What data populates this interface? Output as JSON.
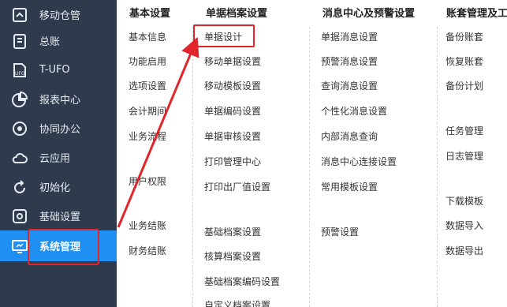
{
  "sidebar": {
    "items": [
      {
        "label": "移动仓管",
        "icon": "warehouse-icon"
      },
      {
        "label": "总账",
        "icon": "ledger-icon"
      },
      {
        "label": "T-UFO",
        "icon": "ufo-report-icon"
      },
      {
        "label": "报表中心",
        "icon": "pie-chart-icon"
      },
      {
        "label": "协同办公",
        "icon": "collaboration-icon"
      },
      {
        "label": "云应用",
        "icon": "cloud-icon"
      },
      {
        "label": "初始化",
        "icon": "refresh-icon"
      },
      {
        "label": "基础设置",
        "icon": "gear-icon"
      },
      {
        "label": "系统管理",
        "icon": "monitor-icon",
        "active": true
      }
    ],
    "active_color": "#1f8ff1"
  },
  "columns": [
    {
      "heading": "基本设置",
      "items": [
        "基本信息",
        "功能启用",
        "选项设置",
        "会计期间",
        "业务流程",
        "用户权限",
        "业务结账",
        "财务结账"
      ]
    },
    {
      "heading": "单据档案设置",
      "items": [
        "单据设计",
        "移动单据设置",
        "移动模板设置",
        "单据编码设置",
        "单据审核设置",
        "打印管理中心",
        "打印出厂值设置",
        "基础档案设置",
        "核算档案设置",
        "基础档案编码设置",
        "自定义档案设置"
      ]
    },
    {
      "heading": "消息中心及预警设置",
      "items": [
        "单据消息设置",
        "预警消息设置",
        "查询消息设置",
        "个性化消息设置",
        "内部消息查询",
        "消息中心连接设置",
        "常用模板设置",
        "预警设置"
      ]
    },
    {
      "heading": "账套管理及工",
      "items": [
        "备份账套",
        "恢复账套",
        "备份计划",
        "任务管理",
        "日志管理",
        "下载模板",
        "数据导入",
        "数据导出"
      ]
    }
  ],
  "highlight_color": "#e0262b"
}
